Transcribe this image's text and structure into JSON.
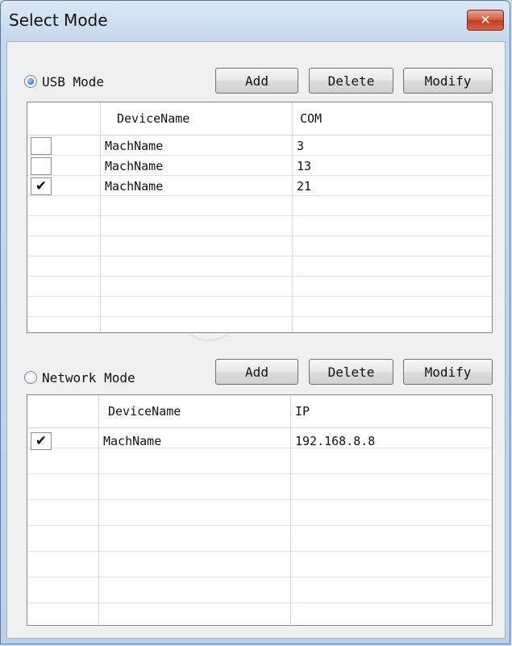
{
  "window": {
    "title": "Select Mode",
    "close_glyph": "✕"
  },
  "usb": {
    "mode_label": "USB Mode",
    "selected": true,
    "buttons": {
      "add": "Add",
      "delete": "Delete",
      "modify": "Modify"
    },
    "columns": [
      "DeviceName",
      "COM"
    ],
    "rows": [
      {
        "checked": false,
        "name": "MachName",
        "value": "3"
      },
      {
        "checked": false,
        "name": "MachName",
        "value": "13"
      },
      {
        "checked": true,
        "name": "MachName",
        "value": "21"
      }
    ]
  },
  "network": {
    "mode_label": "Network Mode",
    "selected": false,
    "buttons": {
      "add": "Add",
      "delete": "Delete",
      "modify": "Modify"
    },
    "columns": [
      "DeviceName",
      "IP"
    ],
    "rows": [
      {
        "checked": true,
        "name": "MachName",
        "value": "192.168.8.8"
      }
    ]
  },
  "check_glyph": "✔",
  "icons": {
    "close": "close-icon",
    "radio": "radio-icon",
    "checkbox": "checkbox-icon"
  }
}
